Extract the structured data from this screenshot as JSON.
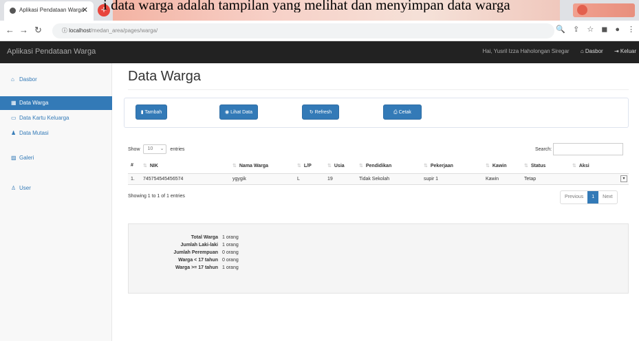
{
  "caption": "i data warga adalah tampilan yang melihat dan menyimpan data warga",
  "browser": {
    "tab_title": "Aplikasi Pendataan Warga",
    "url_host": "localhost",
    "url_path": "/medan_area/pages/warga/"
  },
  "navbar": {
    "brand": "Aplikasi Pendataan Warga",
    "greeting": "Hai, Yusril Izza Haholongan Siregar",
    "dashboard": "Dasbor",
    "logout": "Keluar"
  },
  "sidebar": {
    "items": [
      {
        "label": "Dasbor",
        "icon": "home-icon"
      },
      {
        "label": "Data Warga",
        "icon": "table-icon"
      },
      {
        "label": "Data Kartu Keluarga",
        "icon": "card-icon"
      },
      {
        "label": "Data Mutasi",
        "icon": "users-icon"
      },
      {
        "label": "Galeri",
        "icon": "image-icon"
      },
      {
        "label": "User",
        "icon": "user-icon"
      }
    ]
  },
  "page": {
    "title": "Data Warga",
    "buttons": {
      "add": "Tambah",
      "view": "Lihat Data",
      "refresh": "Refresh",
      "print": "Cetak"
    }
  },
  "table": {
    "show_label": "Show",
    "entries_value": "10",
    "entries_label": "entries",
    "search_label": "Search:",
    "headers": [
      "#",
      "NIK",
      "Nama Warga",
      "L/P",
      "Usia",
      "Pendidikan",
      "Pekerjaan",
      "Kawin",
      "Status",
      "Aksi"
    ],
    "rows": [
      [
        "1.",
        "745754545456574",
        "ygygik",
        "L",
        "19",
        "Tidak Sekolah",
        "supir 1",
        "Kawin",
        "Tetap"
      ]
    ],
    "info": "Showing 1 to 1 of 1 entries",
    "pager": {
      "prev": "Previous",
      "current": "1",
      "next": "Next"
    }
  },
  "summary": [
    {
      "label": "Total Warga",
      "value": "1 orang"
    },
    {
      "label": "Jumlah Laki-laki",
      "value": "1 orang"
    },
    {
      "label": "Jumlah Perempuan",
      "value": "0 orang"
    },
    {
      "label": "Warga < 17 tahun",
      "value": "0 orang"
    },
    {
      "label": "Warga >= 17 tahun",
      "value": "1 orang"
    }
  ],
  "colors": {
    "primary": "#337ab7",
    "navbar": "#222222"
  }
}
